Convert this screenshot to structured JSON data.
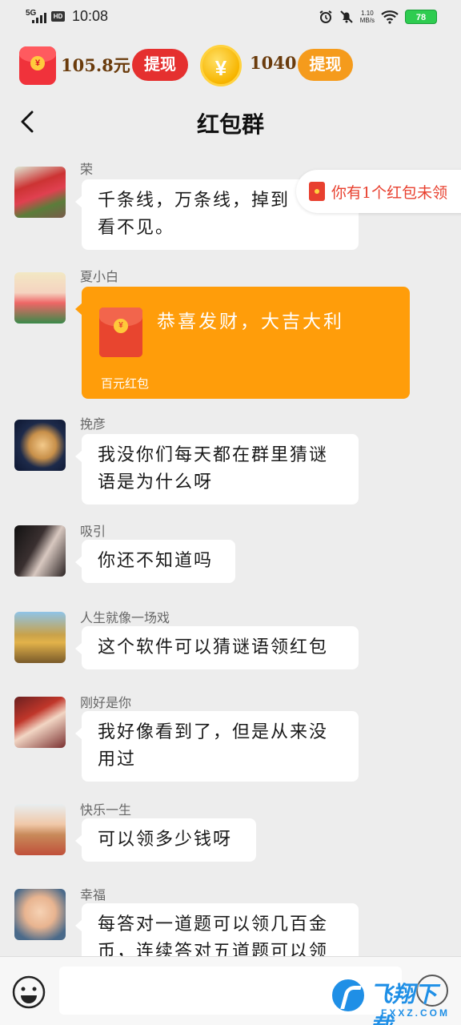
{
  "status": {
    "network": "5G",
    "hd": "HD",
    "time": "10:08",
    "speed": "1.10",
    "speed_unit": "MB/s",
    "battery": "78"
  },
  "rewards": {
    "cash": "105.8元",
    "cash_button": "提现",
    "coins": "1040",
    "coins_button": "提现"
  },
  "nav": {
    "title": "红包群"
  },
  "floating_tip": "你有1个红包未领",
  "messages": [
    {
      "sender": "荣",
      "line1": "千条线，万条线，掉到",
      "line2": "看不见。"
    },
    {
      "sender": "夏小白",
      "redpacket_title": "恭喜发财，大吉大利",
      "redpacket_sub": "百元红包"
    },
    {
      "sender": "挽彦",
      "line1": "我没你们每天都在群里猜谜",
      "line2": "语是为什么呀"
    },
    {
      "sender": "吸引",
      "line1": "你还不知道吗"
    },
    {
      "sender": "人生就像一场戏",
      "line1": "这个软件可以猜谜语领红包"
    },
    {
      "sender": "刚好是你",
      "line1": "我好像看到了，但是从来没",
      "line2": "用过"
    },
    {
      "sender": "快乐一生",
      "line1": "可以领多少钱呀"
    },
    {
      "sender": "幸福",
      "line1": "每答对一道题可以领几百金",
      "line2": "币，连续答对五道题可以领"
    }
  ],
  "input": {
    "placeholder": ""
  },
  "watermark": {
    "text": "飞翔下载",
    "sub": "FXXZ.COM"
  },
  "colors": {
    "accent_orange": "#ff9d0a",
    "accent_red": "#e5302f",
    "background": "#ededed"
  }
}
